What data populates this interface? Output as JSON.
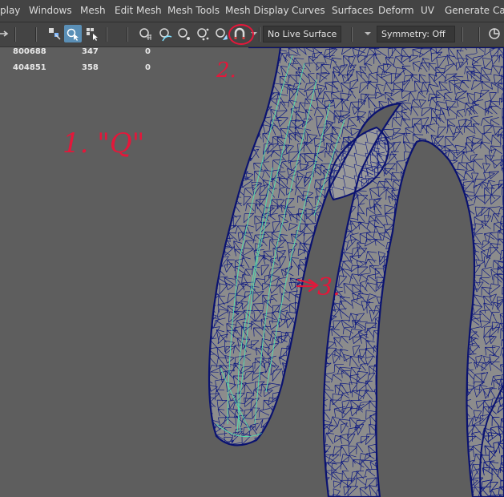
{
  "menu": {
    "items": [
      "play",
      "Windows",
      "Mesh",
      "Edit Mesh",
      "Mesh Tools",
      "Mesh Display",
      "Curves",
      "Surfaces",
      "Deform",
      "UV",
      "Generate",
      "Ca"
    ]
  },
  "toolbar": {
    "live_surface": "No Live Surface",
    "symmetry": "Symmetry: Off",
    "icons": [
      "arrow-icon",
      "select-by-hierarchy-icon",
      "select-by-object-icon",
      "select-by-component-icon",
      "snap-to-grid-icon",
      "snap-to-curve-icon",
      "snap-to-point-icon",
      "snap-to-view-plane-icon",
      "make-live-icon",
      "magnet-icon"
    ]
  },
  "hud": {
    "rows": [
      {
        "a": "800688",
        "b": "347",
        "c": "0"
      },
      {
        "a": "404851",
        "b": "358",
        "c": "0"
      }
    ]
  },
  "annotations": {
    "step1": "1. \"Q\"",
    "step2": "2.",
    "step3": "3."
  },
  "colors": {
    "wire": "#0c1880",
    "highlight": "#4fe0b0",
    "annotation": "#e4173a",
    "viewport_bg": "#5e5e5e",
    "mesh_fill": "#8c8c8c"
  }
}
